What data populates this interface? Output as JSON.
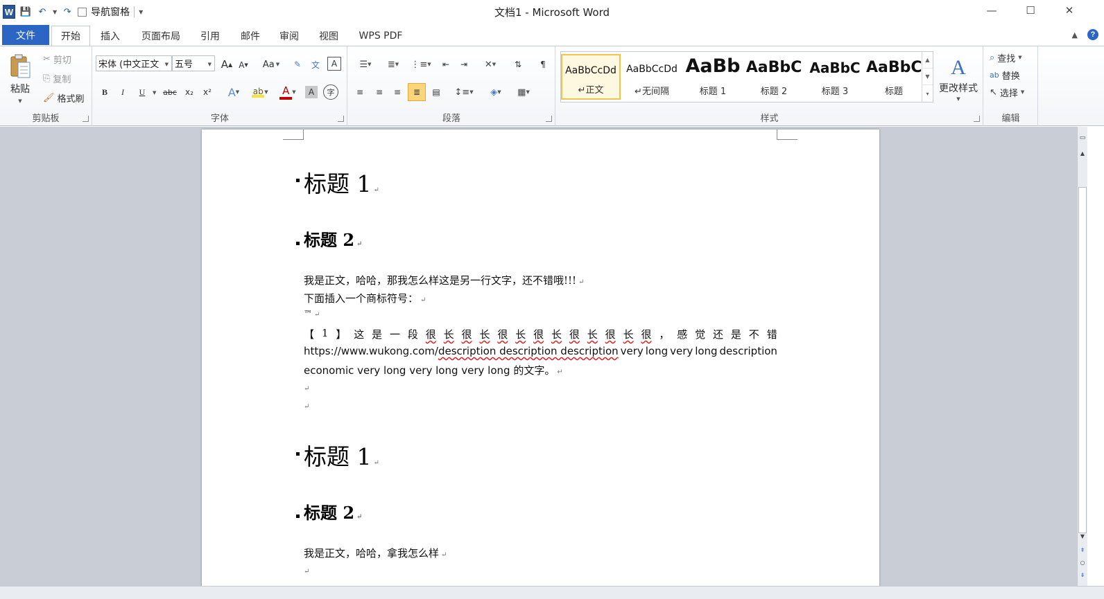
{
  "window": {
    "title": "文档1 - Microsoft Word",
    "minimize": "—",
    "maximize": "☐",
    "close": "✕"
  },
  "qat": {
    "logo": "W",
    "nav_pane_label": "导航窗格"
  },
  "tabs": {
    "file": "文件",
    "items": [
      "开始",
      "插入",
      "页面布局",
      "引用",
      "邮件",
      "审阅",
      "视图",
      "WPS PDF"
    ],
    "help": "?"
  },
  "ribbon": {
    "clipboard": {
      "label": "剪贴板",
      "paste": "粘贴",
      "cut": "剪切",
      "copy": "复制",
      "format_painter": "格式刷"
    },
    "font": {
      "label": "字体",
      "font_name": "宋体 (中文正文",
      "font_size": "五号",
      "grow": "A",
      "shrink": "A",
      "change_case": "Aa",
      "bold": "B",
      "italic": "I",
      "underline": "U",
      "strike": "abc",
      "subscript": "x₂",
      "superscript": "x²",
      "font_color": "A",
      "char_shading": "A",
      "enclose": "字"
    },
    "paragraph": {
      "label": "段落"
    },
    "styles": {
      "label": "样式",
      "items": [
        {
          "sample": "AaBbCcDd",
          "name": "↵正文"
        },
        {
          "sample": "AaBbCcDd",
          "name": "↵无间隔"
        },
        {
          "sample": "AaBb",
          "name": "标题 1"
        },
        {
          "sample": "AaBbC",
          "name": "标题 2"
        },
        {
          "sample": "AaBbC",
          "name": "标题 3"
        },
        {
          "sample": "AaBbC",
          "name": "标题"
        }
      ],
      "change_styles": "更改样式"
    },
    "editing": {
      "label": "编辑",
      "find": "查找",
      "replace": "替换",
      "select": "选择"
    }
  },
  "document": {
    "h1_a": "标题 1",
    "h2_a": "标题 2",
    "p1": "我是正文，哈哈，那我怎么样这是另一行文字，还不错哦!!!",
    "p2": "下面插入一个商标符号：",
    "p3": "™",
    "p4_tokens": [
      "【",
      "1",
      "】",
      "这",
      "是",
      "一",
      "段",
      "很",
      "长",
      "很",
      "长",
      "很",
      "长",
      "很",
      "长",
      "很",
      "长",
      "很",
      "长",
      "很",
      "，",
      "感",
      "觉",
      "还",
      "是",
      "不",
      "错"
    ],
    "p5_url": "https://www.wukong.com/",
    "p5_wavy": "description description description",
    "p5_rest": [
      "very",
      "long",
      "very",
      "long",
      "description"
    ],
    "p6_en": "economic very long very long very long",
    "p6_cn": "的文字。",
    "h1_b": "标题 1",
    "h2_b": "标题 2",
    "p7": "我是正文，哈哈，拿我怎么样",
    "para_mark": "↵"
  }
}
